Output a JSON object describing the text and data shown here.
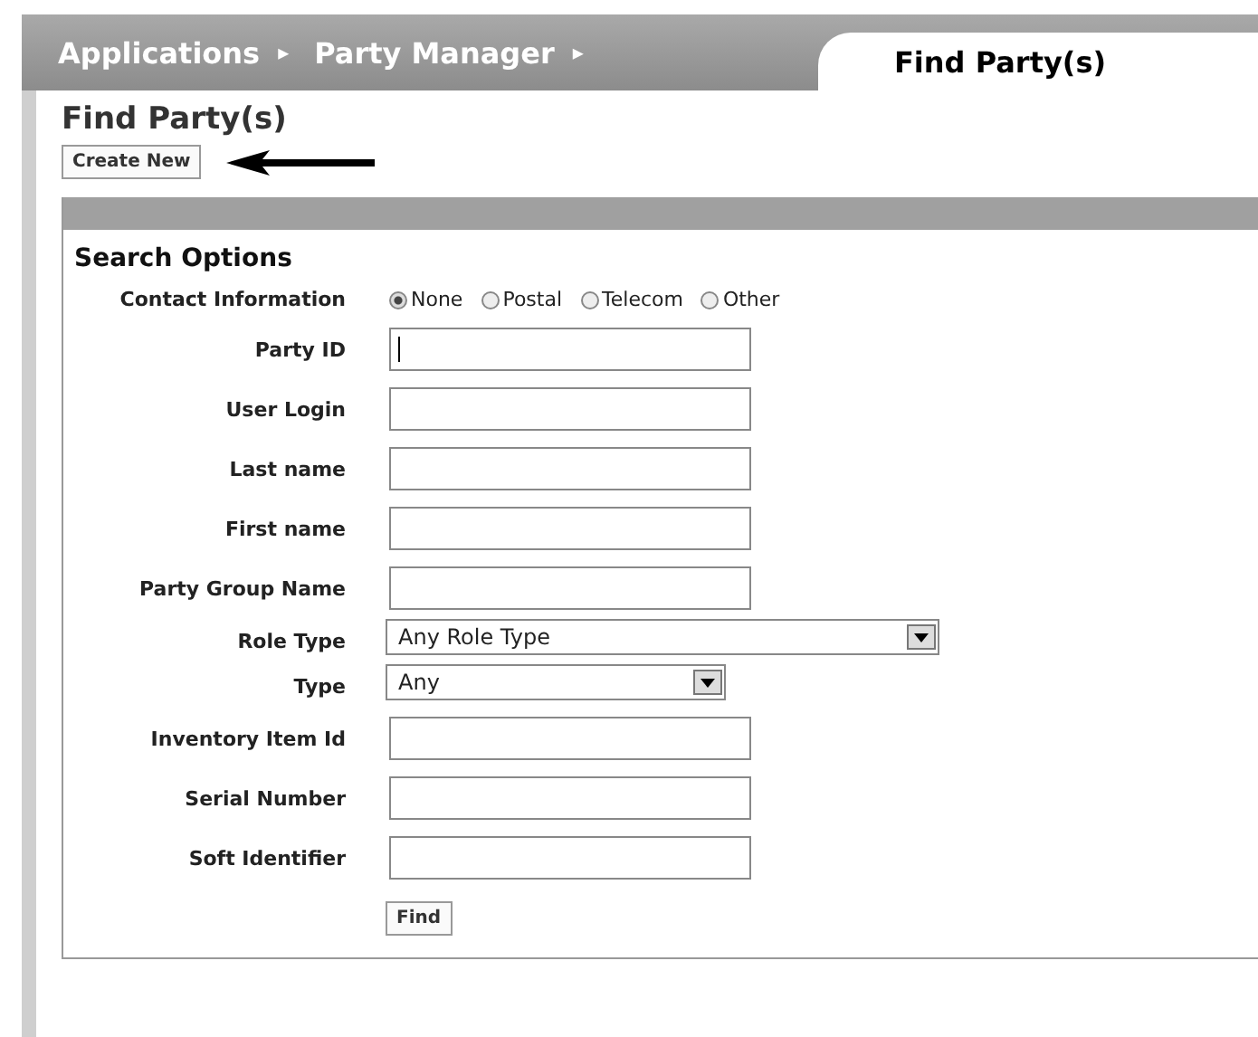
{
  "breadcrumbs": [
    {
      "label": "Applications",
      "separator": "▸"
    },
    {
      "label": "Party Manager",
      "separator": "▸"
    }
  ],
  "active_tab": {
    "label": "Find Party(s)"
  },
  "page_title": "Find Party(s)",
  "create_button": "Create New",
  "section": {
    "title": "Search Options",
    "rows": [
      {
        "kind": "radio",
        "label": "Contact Information",
        "options": [
          {
            "label": "None",
            "selected": true
          },
          {
            "label": "Postal",
            "selected": false
          },
          {
            "label": "Telecom",
            "selected": false
          },
          {
            "label": "Other",
            "selected": false
          }
        ]
      },
      {
        "kind": "text",
        "label": "Party ID",
        "focused": true
      },
      {
        "kind": "text",
        "label": "User Login"
      },
      {
        "kind": "text",
        "label": "Last name"
      },
      {
        "kind": "text",
        "label": "First name"
      },
      {
        "kind": "text",
        "label": "Party Group Name"
      },
      {
        "kind": "select",
        "label": "Role Type",
        "value": "Any Role Type"
      },
      {
        "kind": "select",
        "label": "Type",
        "value": "Any"
      },
      {
        "kind": "text",
        "label": "Inventory Item Id"
      },
      {
        "kind": "text",
        "label": "Serial Number"
      },
      {
        "kind": "text",
        "label": "Soft Identifier"
      },
      {
        "kind": "button",
        "label": "Find"
      }
    ]
  }
}
